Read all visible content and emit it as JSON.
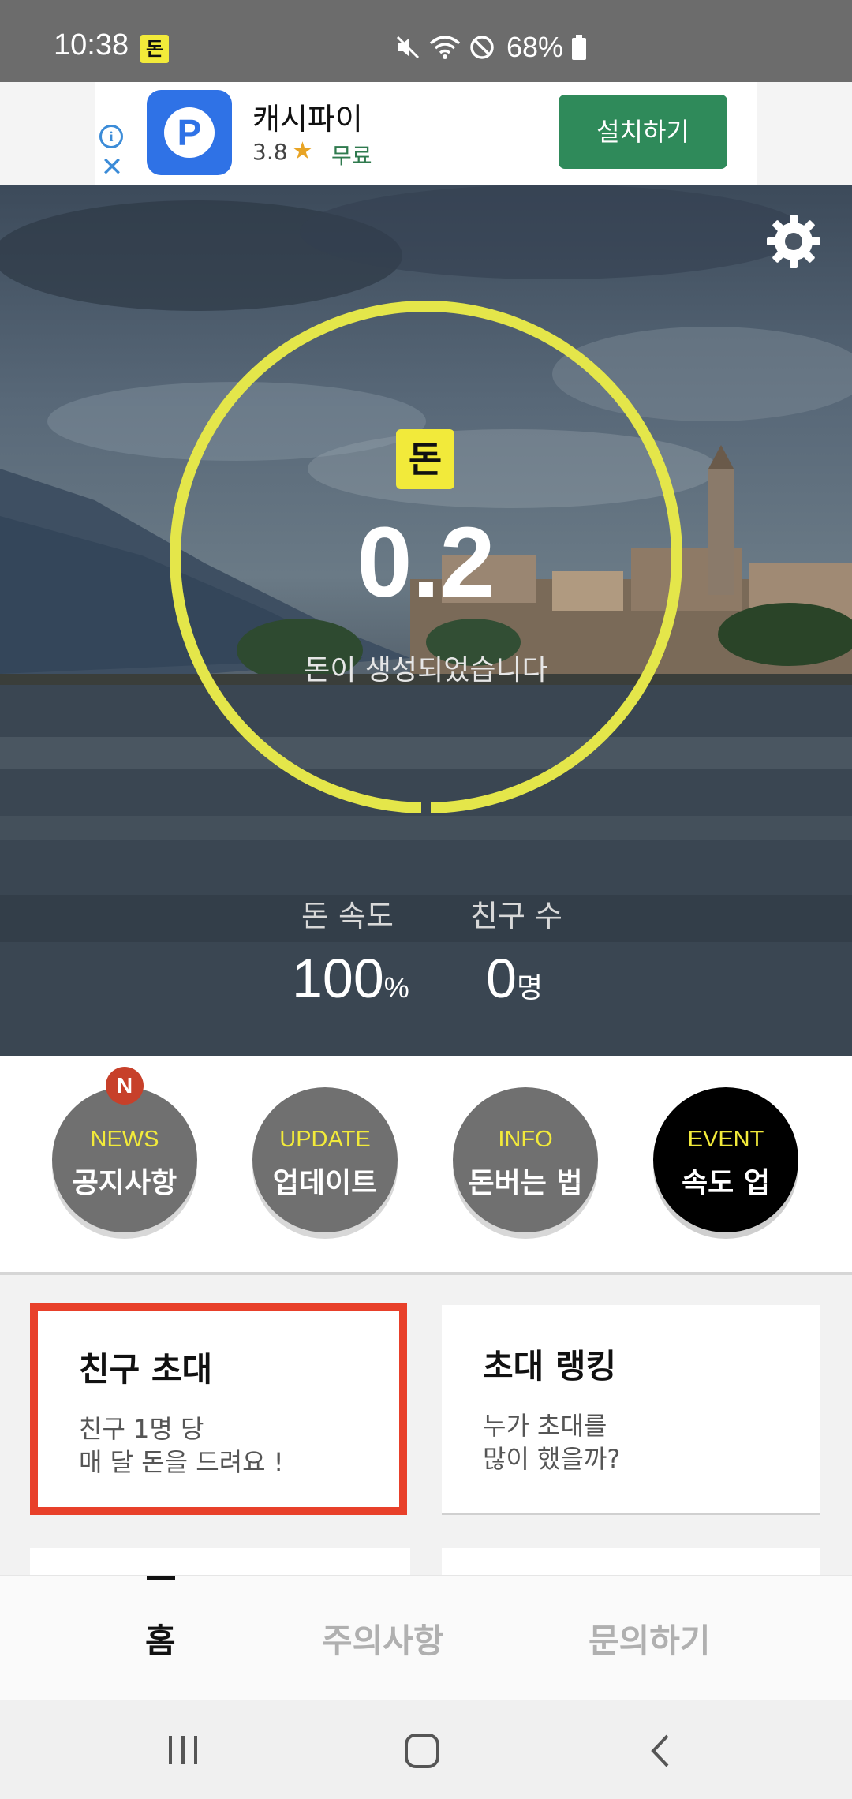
{
  "status_bar": {
    "time": "10:38",
    "app_badge": "돈",
    "battery": "68%"
  },
  "ad": {
    "app_name": "캐시파이",
    "rating": "3.8",
    "price": "무료",
    "install_label": "설치하기",
    "info_icon": "info-icon",
    "close_icon": "close-icon"
  },
  "hero": {
    "badge": "돈",
    "amount": "0.2",
    "subtitle": "돈이 생성되었습니다",
    "speed_label": "돈 속도",
    "speed_value": "100",
    "speed_unit": "%",
    "friends_label": "친구 수",
    "friends_value": "0",
    "friends_unit": "명"
  },
  "circle_buttons": [
    {
      "en": "NEWS",
      "ko": "공지사항",
      "badge": "N"
    },
    {
      "en": "UPDATE",
      "ko": "업데이트"
    },
    {
      "en": "INFO",
      "ko": "돈버는 법"
    },
    {
      "en": "EVENT",
      "ko": "속도 업"
    }
  ],
  "cards": {
    "invite": {
      "title": "친구 초대",
      "line1": "친구 1명 당",
      "line2": "매 달 돈을 드려요 !"
    },
    "ranking": {
      "title": "초대 랭킹",
      "line1": "누가 초대를",
      "line2": "많이 했을까?"
    }
  },
  "tabs": [
    {
      "label": "홈",
      "active": true
    },
    {
      "label": "주의사항",
      "active": false
    },
    {
      "label": "문의하기",
      "active": false
    }
  ],
  "colors": {
    "accent_yellow": "#f2ea3a",
    "ring_yellow": "#e4e64a",
    "install_green": "#2f8a5a",
    "highlight_red": "#e8402a",
    "badge_red": "#c7402a"
  }
}
